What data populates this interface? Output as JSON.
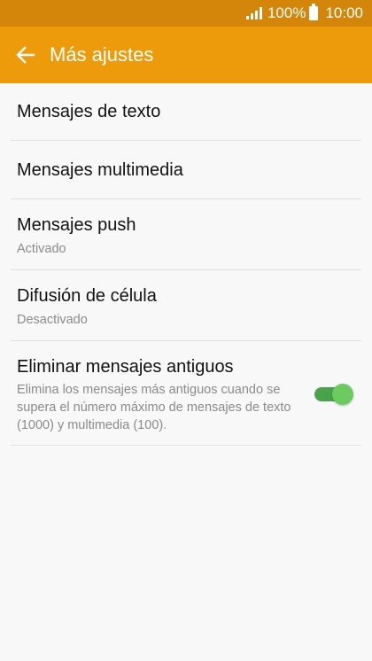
{
  "status_bar": {
    "battery_percent": "100%",
    "time": "10:00",
    "icons": [
      "signal-icon",
      "battery-icon"
    ]
  },
  "action_bar": {
    "back_icon": "arrow-back-icon",
    "title": "Más ajustes"
  },
  "settings": [
    {
      "title": "Mensajes de texto"
    },
    {
      "title": "Mensajes multimedia"
    },
    {
      "title": "Mensajes push",
      "summary": "Activado"
    },
    {
      "title": "Difusión de célula",
      "summary": "Desactivado"
    },
    {
      "title": "Eliminar mensajes antiguos",
      "summary": "Elimina los mensajes más antiguos cuando se supera el número máximo de mensajes de texto (1000) y multimedia (100).",
      "toggle_on": true
    }
  ],
  "colors": {
    "status_bar": "#d4860a",
    "action_bar": "#ed9b0b",
    "toggle_on": "#4aa24a"
  }
}
